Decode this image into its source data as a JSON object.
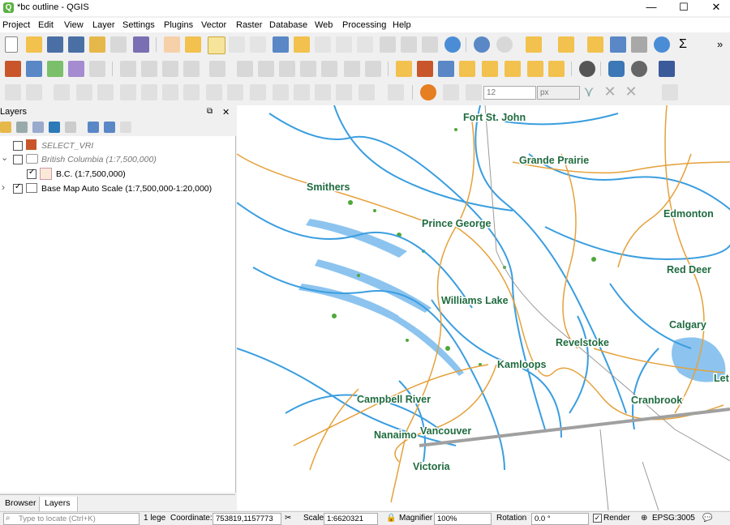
{
  "window": {
    "title": "*bc outline - QGIS",
    "app_icon": "qgis-icon",
    "minimize": "—",
    "maximize": "☐",
    "close": "✕"
  },
  "menu": [
    "Project",
    "Edit",
    "View",
    "Layer",
    "Settings",
    "Plugins",
    "Vector",
    "Raster",
    "Database",
    "Web",
    "Processing",
    "Help"
  ],
  "toolbar": {
    "label_size": "12",
    "label_unit": "px",
    "more": "»"
  },
  "layers_panel": {
    "title": "Layers",
    "undock": "⧉",
    "close": "✕",
    "items": [
      {
        "label": "SELECT_VRI",
        "checked": false,
        "expander": "",
        "swatch": "#c8562a"
      },
      {
        "label": "British Columbia (1:7,500,000)",
        "checked": false,
        "expander": "⌄"
      },
      {
        "label": "B.C. (1:7,500,000)",
        "checked": true,
        "expander": "",
        "swatch": "#fbe9d8"
      },
      {
        "label": "Base Map Auto Scale (1:7,500,000-1:20,000)",
        "checked": true,
        "expander": "›"
      }
    ]
  },
  "tabs": {
    "browser": "Browser",
    "layers": "Layers"
  },
  "status": {
    "locate_placeholder": "Type to locate (Ctrl+K)",
    "legend_msg": "1 lege",
    "coordinate_label": "Coordinate:",
    "coordinate_value": "753819,1157773",
    "scale_label": "Scale",
    "scale_value": "1:6620321",
    "magnifier_label": "Magnifier",
    "magnifier_value": "100%",
    "rotation_label": "Rotation",
    "rotation_value": "0.0 °",
    "render_label": "Render",
    "crs": "EPSG:3005"
  },
  "map": {
    "cities": [
      "Fort St. John",
      "Grande Prairie",
      "Smithers",
      "Edmonton",
      "Prince George",
      "Red Deer",
      "Williams Lake",
      "Calgary",
      "Revelstoke",
      "Kamloops",
      "Campbell River",
      "Cranbrook",
      "Nanaimo",
      "Vancouver",
      "Victoria",
      "Let"
    ],
    "colors": {
      "water": "#3a9ee0",
      "road": "#e5a13a",
      "forest": "#4fa83a",
      "border": "#9a9a9a",
      "label": "#1f6b3f"
    }
  }
}
